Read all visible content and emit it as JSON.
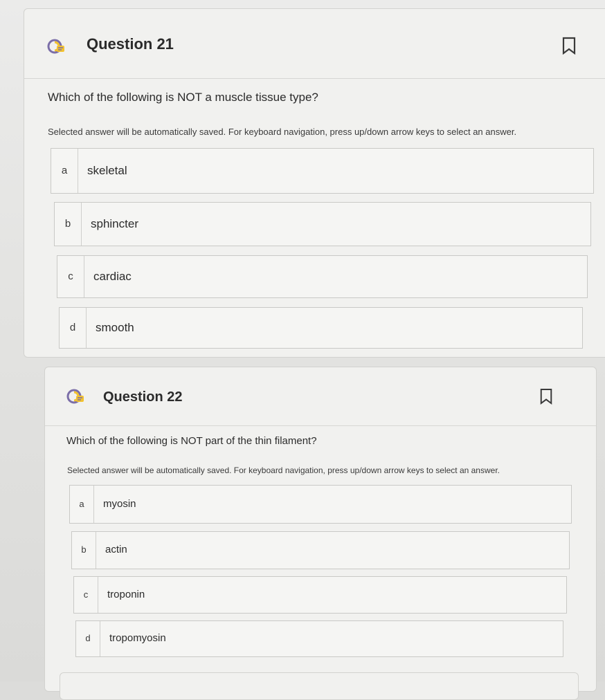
{
  "questions": [
    {
      "title": "Question 21",
      "prompt": "Which of the following is NOT a muscle tissue type?",
      "hint": "Selected answer will be automatically saved. For keyboard navigation, press up/down arrow keys to select an answer.",
      "icon": "question-status-icon",
      "flag_icon": "bookmark-flag-icon",
      "options": [
        {
          "letter": "a",
          "label": "skeletal"
        },
        {
          "letter": "b",
          "label": "sphincter"
        },
        {
          "letter": "c",
          "label": "cardiac"
        },
        {
          "letter": "d",
          "label": "smooth"
        }
      ]
    },
    {
      "title": "Question 22",
      "prompt": "Which of the following is NOT part of the thin filament?",
      "hint": "Selected answer will be automatically saved. For keyboard navigation, press up/down arrow keys to select an answer.",
      "icon": "question-status-icon",
      "flag_icon": "bookmark-flag-icon",
      "options": [
        {
          "letter": "a",
          "label": "myosin"
        },
        {
          "letter": "b",
          "label": "actin"
        },
        {
          "letter": "c",
          "label": "troponin"
        },
        {
          "letter": "d",
          "label": "tropomyosin"
        }
      ]
    }
  ],
  "colors": {
    "icon_accent": "#f2c230",
    "icon_body": "#7b6ea8",
    "border": "#c9c9c6"
  }
}
